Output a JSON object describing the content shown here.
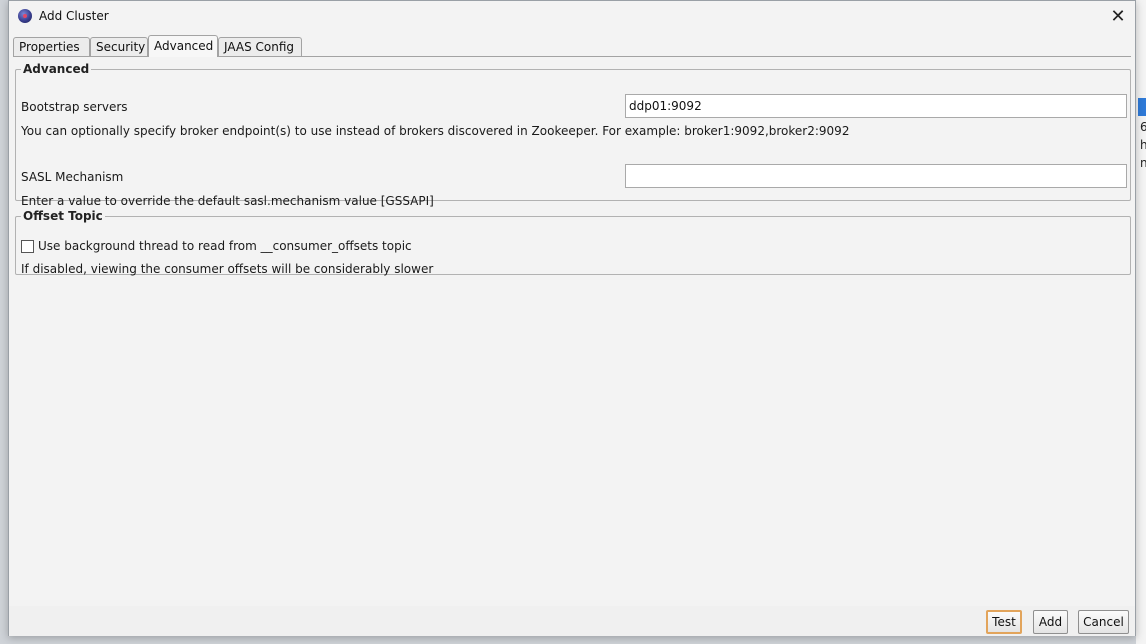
{
  "window": {
    "title": "Add Cluster"
  },
  "tabs": [
    {
      "label": "Properties",
      "active": false
    },
    {
      "label": "Security",
      "active": false
    },
    {
      "label": "Advanced",
      "active": true
    },
    {
      "label": "JAAS Config",
      "active": false
    }
  ],
  "advanced": {
    "legend": "Advanced",
    "bootstrap": {
      "label": "Bootstrap servers",
      "value": "ddp01:9092",
      "help": "You can optionally specify broker endpoint(s) to use instead of brokers discovered in Zookeeper. For example: broker1:9092,broker2:9092"
    },
    "sasl": {
      "label": "SASL Mechanism",
      "value": "",
      "help": "Enter a value to override the default sasl.mechanism value [GSSAPI]"
    }
  },
  "offset_topic": {
    "legend": "Offset Topic",
    "checkbox_label": "Use background thread to read from __consumer_offsets topic",
    "checked": false,
    "help": "If disabled, viewing the consumer offsets will be considerably slower"
  },
  "buttons": {
    "test": "Test",
    "add": "Add",
    "cancel": "Cancel"
  },
  "background": {
    "snippets": [
      "6",
      "h",
      "n"
    ]
  },
  "colors": {
    "default_button_border": "#e2a45b",
    "selection": "#2f7ad8"
  }
}
